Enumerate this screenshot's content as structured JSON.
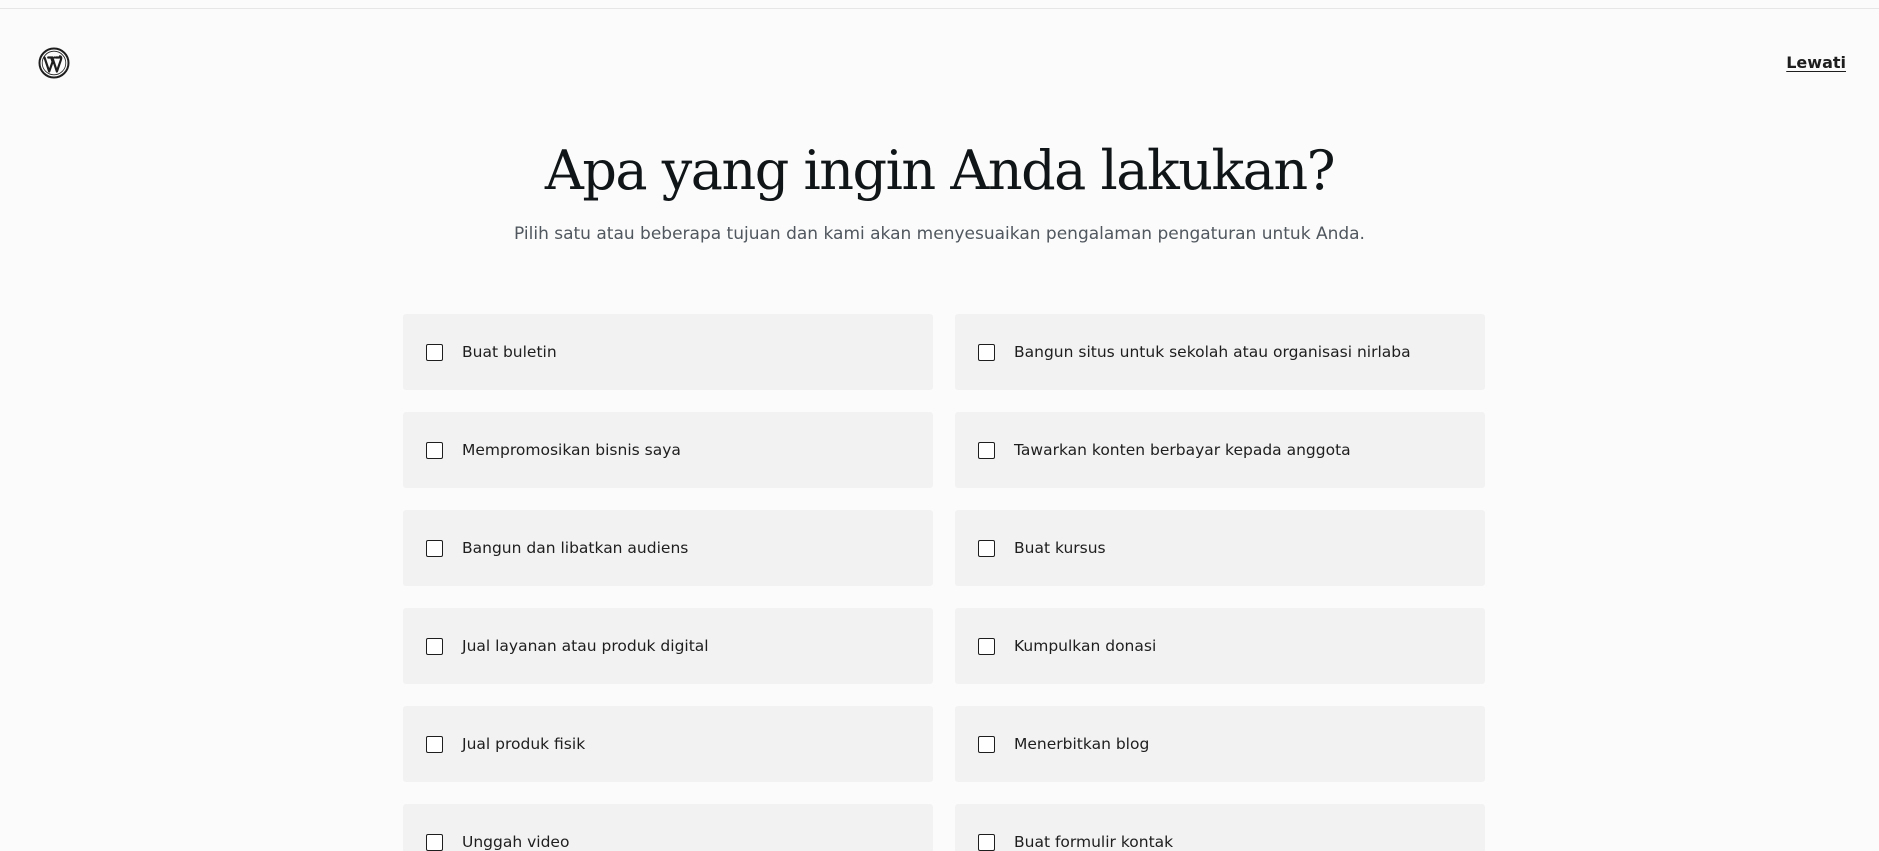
{
  "header": {
    "logo_icon": "wordpress-logo-icon",
    "skip_label": "Lewati"
  },
  "main": {
    "title": "Apa yang ingin Anda lakukan?",
    "subtitle": "Pilih satu atau beberapa tujuan dan kami akan menyesuaikan pengalaman pengaturan untuk Anda."
  },
  "goals": [
    {
      "label": "Buat buletin",
      "checked": false
    },
    {
      "label": "Bangun situs untuk sekolah atau organisasi nirlaba",
      "checked": false
    },
    {
      "label": "Mempromosikan bisnis saya",
      "checked": false
    },
    {
      "label": "Tawarkan konten berbayar kepada anggota",
      "checked": false
    },
    {
      "label": "Bangun dan libatkan audiens",
      "checked": false
    },
    {
      "label": "Buat kursus",
      "checked": false
    },
    {
      "label": "Jual layanan atau produk digital",
      "checked": false
    },
    {
      "label": "Kumpulkan donasi",
      "checked": false
    },
    {
      "label": "Jual produk fisik",
      "checked": false
    },
    {
      "label": "Menerbitkan blog",
      "checked": false
    },
    {
      "label": "Unggah video",
      "checked": false
    },
    {
      "label": "Buat formulir kontak",
      "checked": false
    }
  ]
}
